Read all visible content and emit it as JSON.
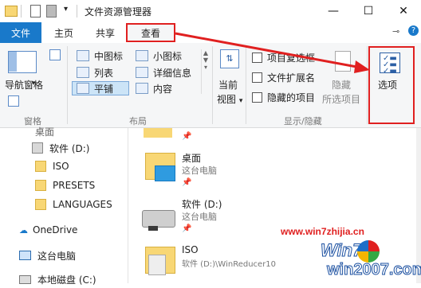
{
  "window": {
    "title": "文件资源管理器"
  },
  "tabs": {
    "file": "文件",
    "home": "主页",
    "share": "共享",
    "view": "查看"
  },
  "ribbon": {
    "nav_pane_label": "导航窗格",
    "pane_group": "窗格",
    "layout": {
      "items": [
        "中图标",
        "小图标",
        "列表",
        "详细信息",
        "平铺",
        "内容"
      ],
      "group": "布局",
      "selected": "平铺"
    },
    "current_view": {
      "line1": "当前",
      "line2": "视图"
    },
    "show_hide": {
      "checkboxes": [
        "项目复选框",
        "文件扩展名",
        "隐藏的项目"
      ],
      "hide_selected": [
        "隐藏",
        "所选项目"
      ],
      "group": "显示/隐藏"
    },
    "options_label": "选项"
  },
  "nav": {
    "items": [
      "桌面",
      "软件 (D:)",
      "ISO",
      "PRESETS",
      "LANGUAGES",
      "OneDrive",
      "这台电脑",
      "本地磁盘 (C:)"
    ]
  },
  "content": {
    "items": [
      {
        "name": "桌面",
        "sub": "这台电脑"
      },
      {
        "name": "软件 (D:)",
        "sub": "这台电脑"
      },
      {
        "name": "ISO",
        "sub": "软件 (D:)\\WinReducer10"
      }
    ]
  },
  "watermark": {
    "url": "www.win7zhijia.cn",
    "logo": "Win7",
    "site": "win2007.com"
  },
  "colors": {
    "accent": "#1979ca",
    "highlight": "#e02020"
  }
}
